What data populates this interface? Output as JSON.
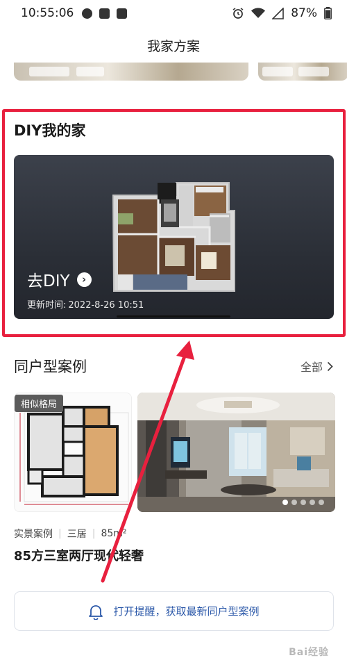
{
  "status_bar": {
    "time": "10:55:06",
    "battery": "87%"
  },
  "header": {
    "title": "我家方案"
  },
  "diy": {
    "section_title": "DIY我的家",
    "cta_label": "去DIY",
    "updated_label": "更新时间:",
    "updated_value": "2022-8-26 10:51"
  },
  "similar": {
    "section_title": "同户型案例",
    "see_all": "全部",
    "badge": "相似格局",
    "meta_type": "实景案例",
    "meta_rooms": "三居",
    "meta_area": "85m²",
    "case_title": "85方三室两厅现代轻奢",
    "photo_pages": 5,
    "photo_current": 1
  },
  "reminder": {
    "label": "打开提醒，获取最新同户型案例"
  },
  "watermark": {
    "text": "Bai经验"
  },
  "colors": {
    "annotation_red": "#e8203e",
    "link_blue": "#2a57a8",
    "diy_card_bg": "#2b2f37"
  },
  "icons": [
    "message-icon",
    "mail-icon",
    "alarm-icon",
    "wifi-icon",
    "signal-icon",
    "battery-icon",
    "chevron-right-icon",
    "bell-icon"
  ]
}
